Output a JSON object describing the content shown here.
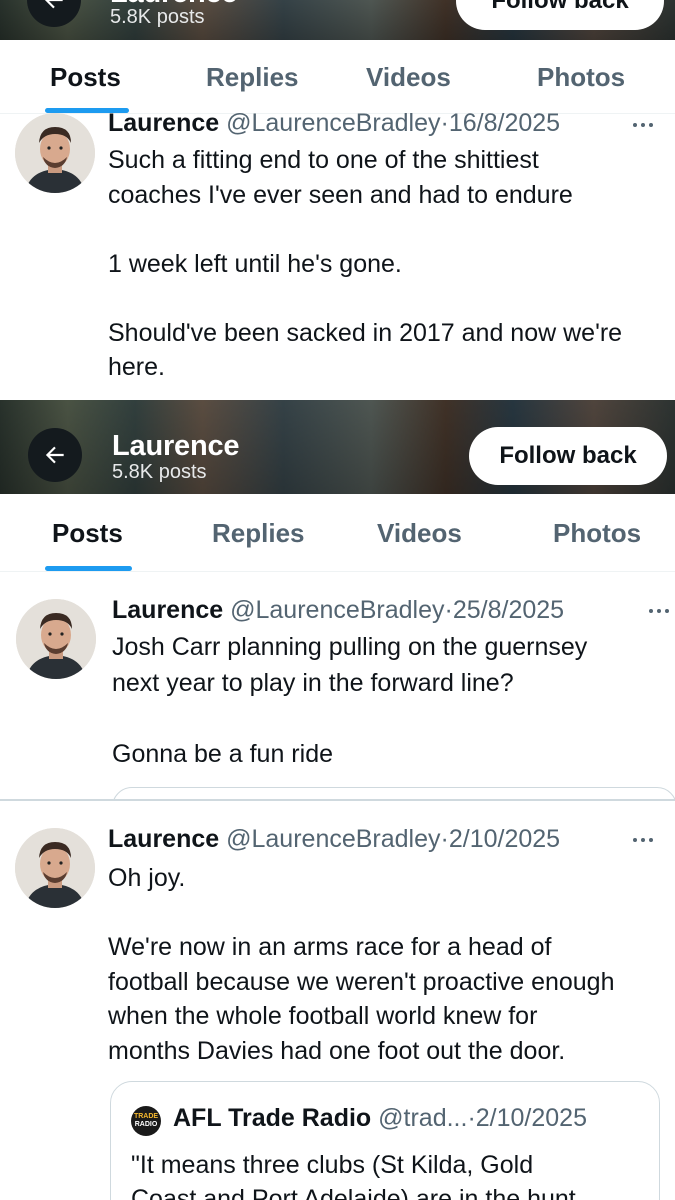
{
  "profile": {
    "name": "Laurence",
    "post_count": "5.8K posts",
    "follow_label": "Follow back"
  },
  "tabs": [
    {
      "label": "Posts",
      "active": true
    },
    {
      "label": "Replies",
      "active": false
    },
    {
      "label": "Videos",
      "active": false
    },
    {
      "label": "Photos",
      "active": false
    }
  ],
  "posts": [
    {
      "author": "Laurence",
      "handle": "@LaurenceBradley",
      "separator": "·",
      "date": "16/8/2025",
      "text": "Such a fitting end to one of the shittiest\ncoaches I've ever seen and had to endure\n\n1 week left until he's gone.\n\nShould've been sacked in 2017 and now we're\nhere."
    },
    {
      "author": "Laurence",
      "handle": "@LaurenceBradley",
      "separator": "·",
      "date": "25/8/2025",
      "text": "Josh Carr planning pulling on the guernsey\nnext year to play in the forward line?\n\nGonna be a fun ride"
    },
    {
      "author": "Laurence",
      "handle": "@LaurenceBradley",
      "separator": "·",
      "date": "2/10/2025",
      "text": "Oh joy.\n\nWe're now in an arms race for a head of\nfootball because we weren't proactive enough\nwhen the whole football world knew for\nmonths Davies had one foot out the door.",
      "quote": {
        "logo_top": "TRADE",
        "logo_bottom": "RADIO",
        "name": "AFL Trade Radio",
        "handle": "@trad...",
        "separator": "·",
        "date": "2/10/2025",
        "text": "\"It means three clubs (St Kilda, Gold\nCoast and Port Adelaide) are in the hunt"
      }
    }
  ],
  "colors": {
    "accent": "#1d9bf0",
    "text_primary": "#0f1419",
    "text_secondary": "#536471",
    "border": "#cfd9de"
  },
  "icons": [
    "back-arrow-icon",
    "more-icon"
  ]
}
